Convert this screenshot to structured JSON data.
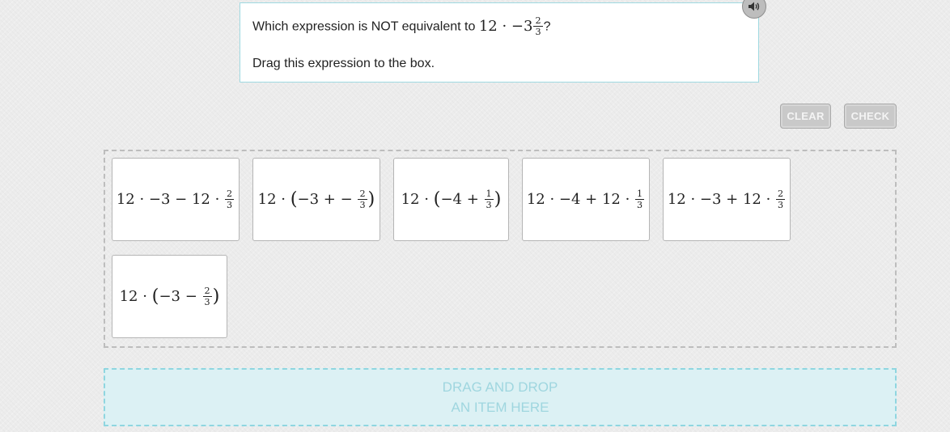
{
  "prompt": {
    "question_text": "Which expression is NOT equivalent to",
    "question_math": {
      "lead": "12 · −3",
      "num": "2",
      "den": "3"
    },
    "question_end": "?",
    "instruction": "Drag this expression to the box."
  },
  "audio": {
    "icon": "speaker-icon"
  },
  "buttons": {
    "clear": "CLEAR",
    "check": "CHECK"
  },
  "cards": [
    {
      "type": "a",
      "pre": "12 · −3 − 12 ·",
      "num": "2",
      "den": "3"
    },
    {
      "type": "b",
      "pre": "12 ·",
      "inner": "−3 + −",
      "num": "2",
      "den": "3"
    },
    {
      "type": "b",
      "pre": "12 ·",
      "inner": "−4 +",
      "num": "1",
      "den": "3"
    },
    {
      "type": "a",
      "pre": "12 · −4 + 12 ·",
      "num": "1",
      "den": "3"
    },
    {
      "type": "a",
      "pre": "12 · −3 + 12 ·",
      "num": "2",
      "den": "3"
    },
    {
      "type": "b",
      "pre": "12 ·",
      "inner": "−3 −",
      "num": "2",
      "den": "3"
    }
  ],
  "drop_zone": {
    "line1": "DRAG AND DROP",
    "line2": "AN ITEM HERE"
  },
  "colors": {
    "accent": "#9fd9e1",
    "drop_bg": "#dcf1f4",
    "button": "#c9c9c9"
  }
}
